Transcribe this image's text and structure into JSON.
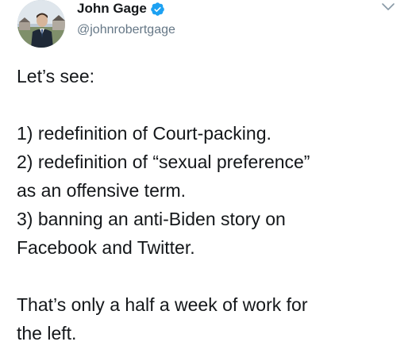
{
  "author": {
    "display_name": "John Gage",
    "handle": "@johnrobertgage",
    "verified": true,
    "avatar_icon": "profile-photo",
    "verified_color": "#1da1f2"
  },
  "menu": {
    "icon": "chevron-down-icon"
  },
  "tweet": {
    "intro": "Let’s see:",
    "lines": [
      "1) redefinition of Court-packing.",
      "2) redefinition of “sexual preference”",
      "as an offensive term.",
      "3) banning an anti-Biden story on",
      "Facebook and Twitter."
    ],
    "closing_1": "That’s only a half a week of work for",
    "closing_2": "the left."
  }
}
